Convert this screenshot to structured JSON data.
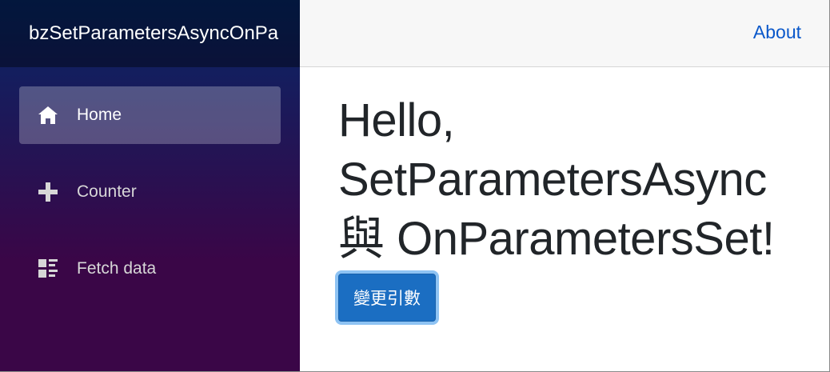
{
  "sidebar": {
    "brand": "bzSetParametersAsyncOnPa",
    "items": [
      {
        "label": "Home",
        "icon": "home-icon",
        "active": true
      },
      {
        "label": "Counter",
        "icon": "plus-icon",
        "active": false
      },
      {
        "label": "Fetch data",
        "icon": "list-rich-icon",
        "active": false
      }
    ]
  },
  "top_row": {
    "about_label": "About"
  },
  "main": {
    "heading_line1": "Hello,",
    "heading_line2": "SetParametersAsync",
    "heading_line3": "與 OnParametersSet!",
    "button_label": "變更引數"
  },
  "colors": {
    "sidebar_top": "#052767",
    "sidebar_bottom": "#3a0647",
    "link": "#0a58ca",
    "button": "#1b6ec2",
    "button_focus_ring": "#8ec3f3"
  }
}
